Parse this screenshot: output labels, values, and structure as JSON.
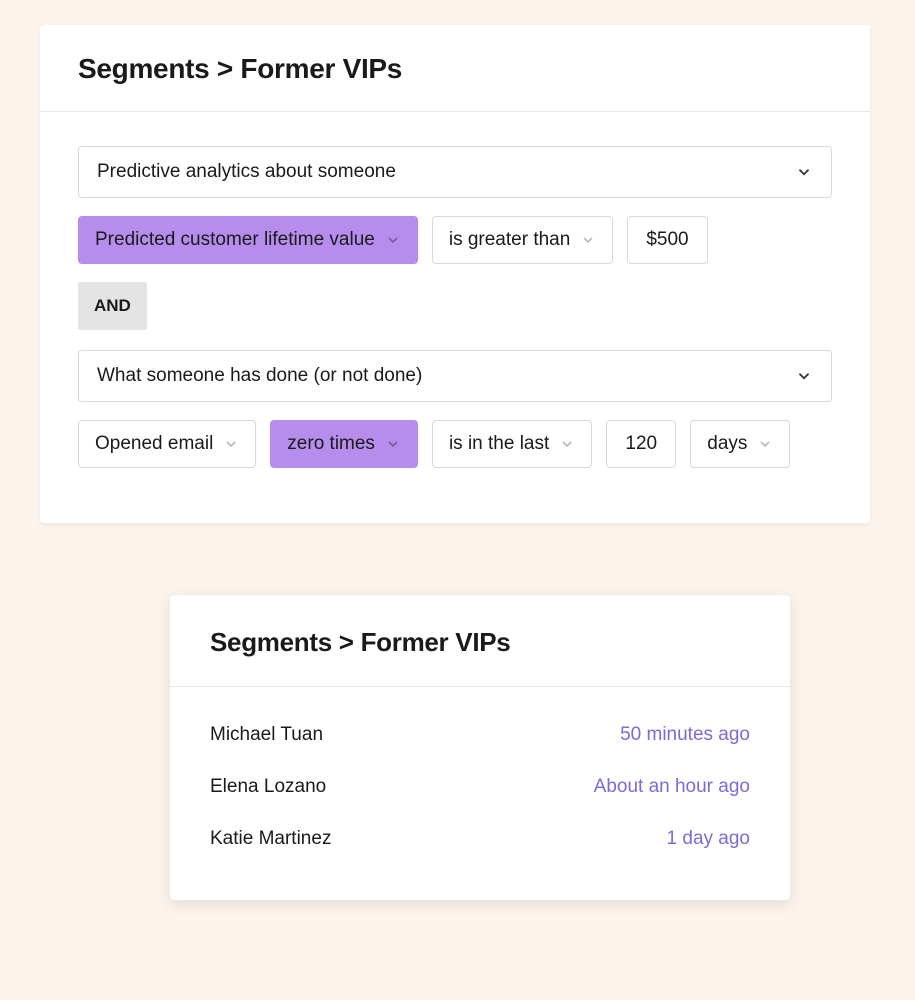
{
  "top": {
    "breadcrumb": "Segments > Former VIPs",
    "condition1": {
      "category": "Predictive analytics about someone",
      "metric": "Predicted customer lifetime value",
      "comparator": "is greater than",
      "value": "$500"
    },
    "logic": "AND",
    "condition2": {
      "category": "What someone has done (or not done)",
      "event": "Opened email",
      "count": "zero times",
      "range_op": "is in the last",
      "range_value": "120",
      "range_unit": "days"
    }
  },
  "bottom": {
    "breadcrumb": "Segments > Former VIPs",
    "members": [
      {
        "name": "Michael Tuan",
        "time": "50 minutes ago"
      },
      {
        "name": "Elena Lozano",
        "time": "About an hour ago"
      },
      {
        "name": "Katie Martinez",
        "time": "1 day ago"
      }
    ]
  }
}
